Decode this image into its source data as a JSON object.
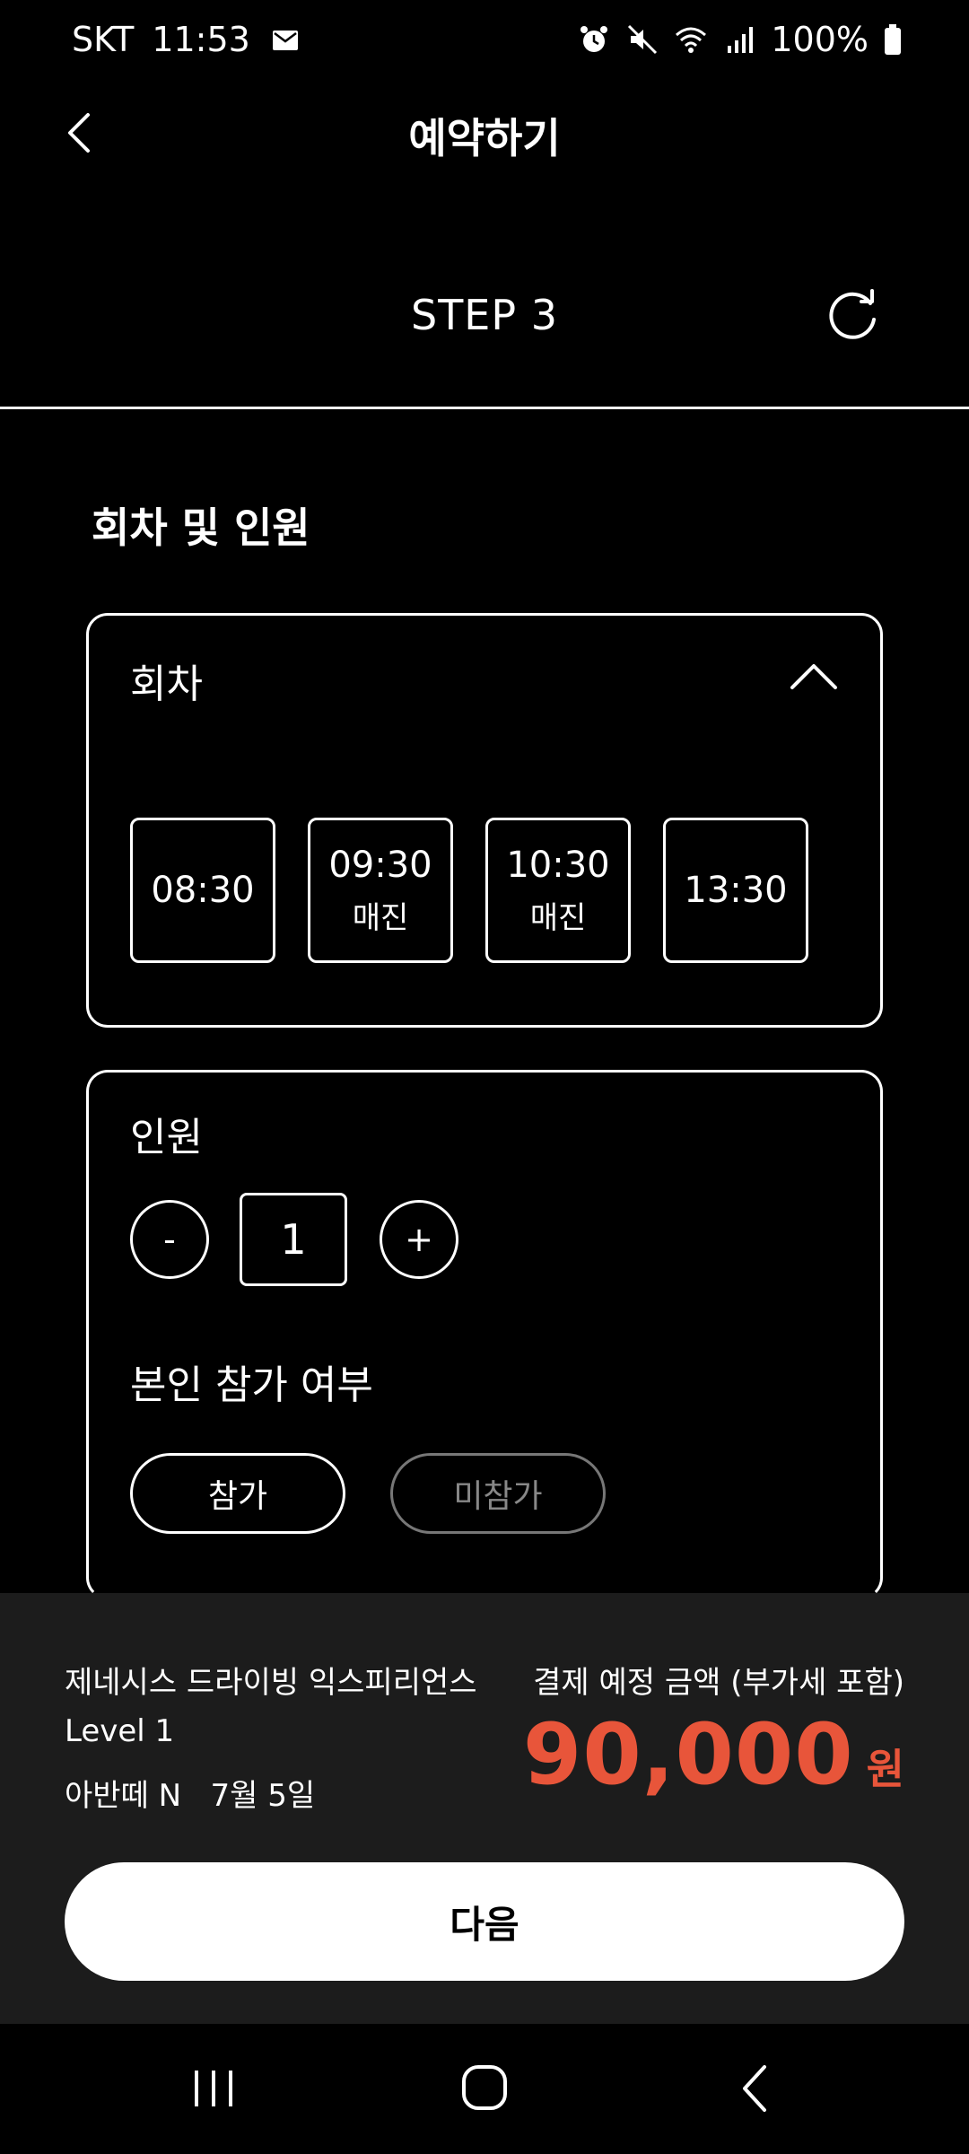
{
  "status": {
    "carrier": "SKT",
    "time": "11:53",
    "battery": "100%"
  },
  "header": {
    "title": "예약하기"
  },
  "step": "STEP 3",
  "section_title": "회차 및 인원",
  "session": {
    "label": "회차",
    "times": [
      {
        "time": "08:30",
        "status": ""
      },
      {
        "time": "09:30",
        "status": "매진"
      },
      {
        "time": "10:30",
        "status": "매진"
      },
      {
        "time": "13:30",
        "status": ""
      }
    ]
  },
  "people": {
    "label": "인원",
    "minus": "-",
    "count": "1",
    "plus": "+",
    "participation_label": "본인 참가 여부",
    "attend": "참가",
    "not_attend": "미참가"
  },
  "summary": {
    "product": "제네시스 드라이빙 익스피리언스",
    "level": "Level 1",
    "venue": "아반떼 N",
    "date": "7월 5일",
    "pay_label": "결제 예정 금액 (부가세 포함)",
    "amount": "90,000",
    "currency": "원",
    "next": "다음"
  },
  "colors": {
    "accent": "#e8553a",
    "panel": "#1c1c1c"
  }
}
